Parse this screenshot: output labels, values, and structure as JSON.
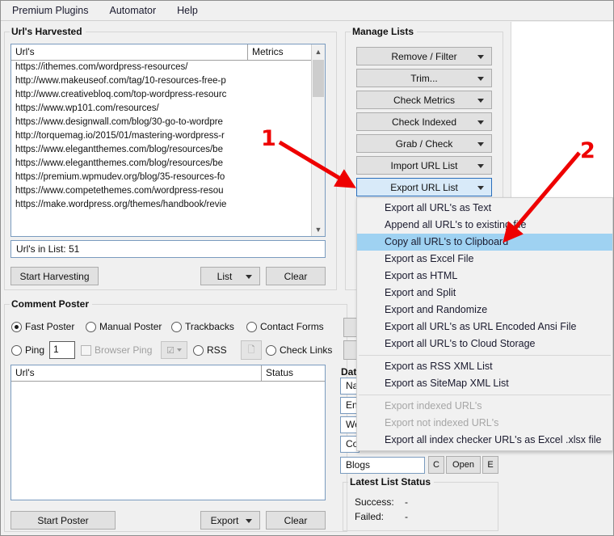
{
  "menubar": {
    "items": [
      {
        "label": "Premium Plugins"
      },
      {
        "label": "Automator"
      },
      {
        "label": "Help"
      }
    ]
  },
  "harvested": {
    "title": "Url's Harvested",
    "columns": [
      "Url's",
      "Metrics"
    ],
    "urls": [
      "https://ithemes.com/wordpress-resources/",
      "http://www.makeuseof.com/tag/10-resources-free-p",
      "http://www.creativebloq.com/top-wordpress-resourc",
      "https://www.wp101.com/resources/",
      "https://www.designwall.com/blog/30-go-to-wordpre",
      "http://torquemag.io/2015/01/mastering-wordpress-r",
      "https://www.elegantthemes.com/blog/resources/be",
      "https://www.elegantthemes.com/blog/resources/be",
      "https://premium.wpmudev.org/blog/35-resources-fo",
      "https://www.competethemes.com/wordpress-resou",
      "https://make.wordpress.org/themes/handbook/revie"
    ],
    "count_label": "Url's in List: 51",
    "start_button": "Start Harvesting",
    "list_button": "List",
    "clear_button": "Clear"
  },
  "manage_lists": {
    "title": "Manage Lists",
    "buttons": [
      {
        "label": "Remove / Filter",
        "selected": false
      },
      {
        "label": "Trim...",
        "selected": false
      },
      {
        "label": "Check Metrics",
        "selected": false
      },
      {
        "label": "Check Indexed",
        "selected": false
      },
      {
        "label": "Grab / Check",
        "selected": false
      },
      {
        "label": "Import URL List",
        "selected": false
      },
      {
        "label": "Export URL List",
        "selected": true
      }
    ]
  },
  "export_menu": {
    "items": [
      {
        "label": "Export all URL's as Text",
        "highlighted": false,
        "disabled": false,
        "separator_after": false
      },
      {
        "label": "Append all URL's to existing file",
        "highlighted": false,
        "disabled": false,
        "separator_after": false
      },
      {
        "label": "Copy all URL's to Clipboard",
        "highlighted": true,
        "disabled": false,
        "separator_after": false
      },
      {
        "label": "Export as Excel File",
        "highlighted": false,
        "disabled": false,
        "separator_after": false
      },
      {
        "label": "Export as HTML",
        "highlighted": false,
        "disabled": false,
        "separator_after": false
      },
      {
        "label": "Export and Split",
        "highlighted": false,
        "disabled": false,
        "separator_after": false
      },
      {
        "label": "Export and Randomize",
        "highlighted": false,
        "disabled": false,
        "separator_after": false
      },
      {
        "label": "Export all URL's as URL Encoded Ansi File",
        "highlighted": false,
        "disabled": false,
        "separator_after": false
      },
      {
        "label": "Export all URL's to Cloud Storage",
        "highlighted": false,
        "disabled": false,
        "separator_after": true
      },
      {
        "label": "Export as RSS XML List",
        "highlighted": false,
        "disabled": false,
        "separator_after": false
      },
      {
        "label": "Export as SiteMap XML List",
        "highlighted": false,
        "disabled": false,
        "separator_after": true
      },
      {
        "label": "Export indexed URL's",
        "highlighted": false,
        "disabled": true,
        "separator_after": false
      },
      {
        "label": "Export not indexed URL's",
        "highlighted": false,
        "disabled": true,
        "separator_after": false
      },
      {
        "label": "Export all index checker URL's as Excel .xlsx file",
        "highlighted": false,
        "disabled": false,
        "separator_after": false
      }
    ]
  },
  "comment_poster": {
    "title": "Comment Poster",
    "modes": [
      {
        "label": "Fast Poster",
        "selected": true
      },
      {
        "label": "Manual Poster",
        "selected": false
      },
      {
        "label": "Trackbacks",
        "selected": false
      },
      {
        "label": "Contact Forms",
        "selected": false
      }
    ],
    "ping": {
      "label": "Ping",
      "selected": false,
      "value": "1"
    },
    "browser_ping": {
      "label": "Browser Ping",
      "checked": false
    },
    "rss": {
      "label": "RSS",
      "selected": false
    },
    "check_links": {
      "label": "Check Links",
      "selected": false
    },
    "columns": [
      "Url's",
      "Status"
    ],
    "rows": [],
    "start_button": "Start Poster",
    "export_button": "Export",
    "clear_button": "Clear"
  },
  "data_panel": {
    "title": "Dat",
    "fields": [
      "Na",
      "En",
      "We",
      "Co"
    ],
    "blogs_value": "Blogs",
    "buttons": [
      "C",
      "Open",
      "E"
    ]
  },
  "latest_list_status": {
    "title": "Latest List Status",
    "rows": [
      {
        "label": "Success:",
        "value": "-"
      },
      {
        "label": "Failed:",
        "value": "-"
      }
    ]
  },
  "annotations": [
    {
      "label": "1"
    },
    {
      "label": "2"
    }
  ],
  "colors": {
    "highlight": "#9fd2f2",
    "selected_button": "#d8eaf9",
    "selected_border": "#2a6ebb",
    "annotation": "#ee0000",
    "window_bg": "#f0f0f0"
  }
}
